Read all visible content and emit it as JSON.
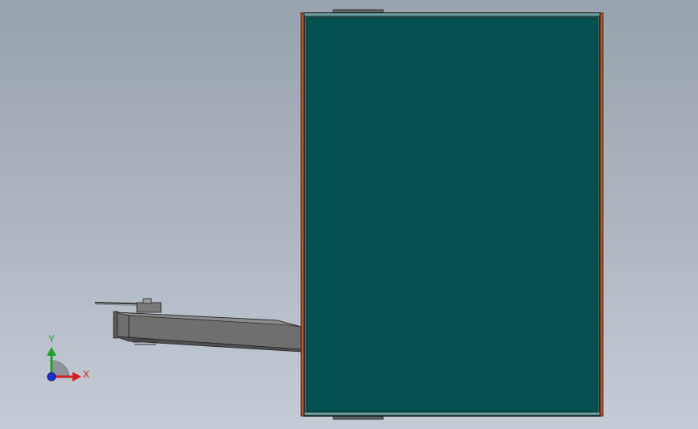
{
  "viewport": {
    "background_top": "#98a3ae",
    "background_bottom": "#c5ccd6"
  },
  "model": {
    "panel_face_color": "#035050",
    "panel_edge_color": "#1a1a1a",
    "side_flange_color": "#b5532b",
    "tab_color": "#5f6466",
    "arm_color": "#6e6e6e"
  },
  "triad": {
    "y_label": "Y",
    "x_label": "X",
    "y_color": "#1fa22d",
    "x_color": "#d21f1f",
    "z_color": "#1f2fd2"
  }
}
